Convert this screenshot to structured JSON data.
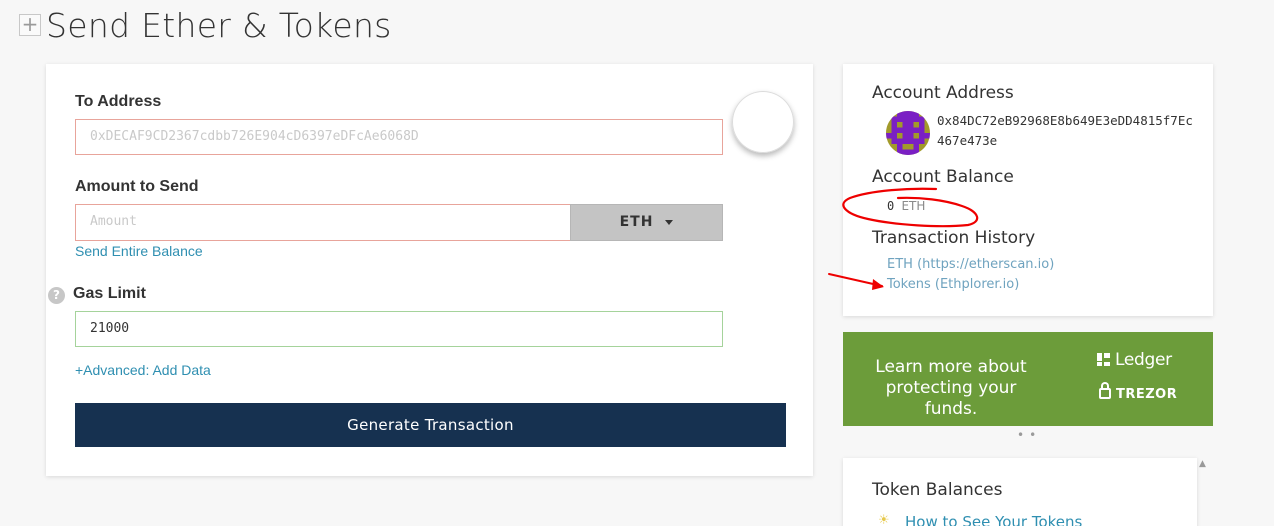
{
  "page": {
    "toggle_symbol": "+",
    "title": "Send Ether & Tokens"
  },
  "send_form": {
    "to_address": {
      "label": "To Address",
      "placeholder": "0xDECAF9CD2367cdbb726E904cD6397eDFcAe6068D"
    },
    "amount": {
      "label": "Amount to Send",
      "placeholder": "Amount",
      "unit": "ETH",
      "send_entire_balance": "Send Entire Balance"
    },
    "gas_limit": {
      "label": "Gas Limit",
      "help_symbol": "?",
      "value": "21000"
    },
    "advanced_link": "+Advanced: Add Data",
    "generate_button": "Generate Transaction"
  },
  "account": {
    "address_heading": "Account Address",
    "address": "0x84DC72eB92968E8b649E3eDD4815f7Ec467e473e",
    "balance_heading": "Account Balance",
    "balance_amount": "0",
    "balance_unit": "ETH",
    "history_heading": "Transaction History",
    "history_links": [
      "ETH (https://etherscan.io)",
      "Tokens (Ethplorer.io)"
    ]
  },
  "promo": {
    "text": "Learn more about protecting your funds.",
    "ledger_label": "Ledger",
    "trezor_label": "TREZOR",
    "carousel_dots": "••"
  },
  "tokens": {
    "heading": "Token Balances",
    "how_to_link": "How to See Your Tokens"
  },
  "colors": {
    "navy_button": "#163150",
    "link_blue": "#2f8fb1",
    "promo_green": "#6c9c3a",
    "invalid_border": "#e8a49b",
    "valid_border": "#a5d39b",
    "annotation_red": "#ee0000",
    "identicon_purple": "#7a1fc4",
    "identicon_olive": "#a29a2a"
  }
}
